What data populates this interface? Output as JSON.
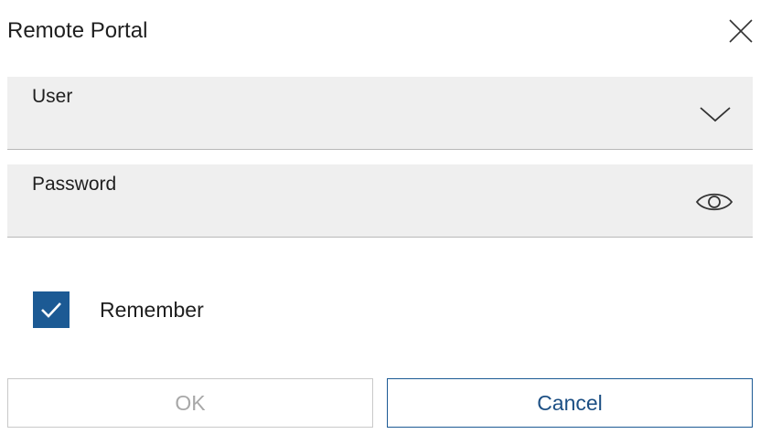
{
  "dialog": {
    "title": "Remote Portal",
    "close_icon": "close-icon"
  },
  "user_field": {
    "label": "User",
    "value": "",
    "icon": "chevron-down-icon"
  },
  "password_field": {
    "label": "Password",
    "value": "",
    "icon": "eye-icon"
  },
  "remember": {
    "label": "Remember",
    "checked": true,
    "checkbox_color": "#1c5a94"
  },
  "buttons": {
    "ok_label": "OK",
    "ok_enabled": false,
    "cancel_label": "Cancel"
  },
  "colors": {
    "accent": "#1c5a94",
    "field_background": "#efefef",
    "disabled_text": "#a8a8a8"
  }
}
